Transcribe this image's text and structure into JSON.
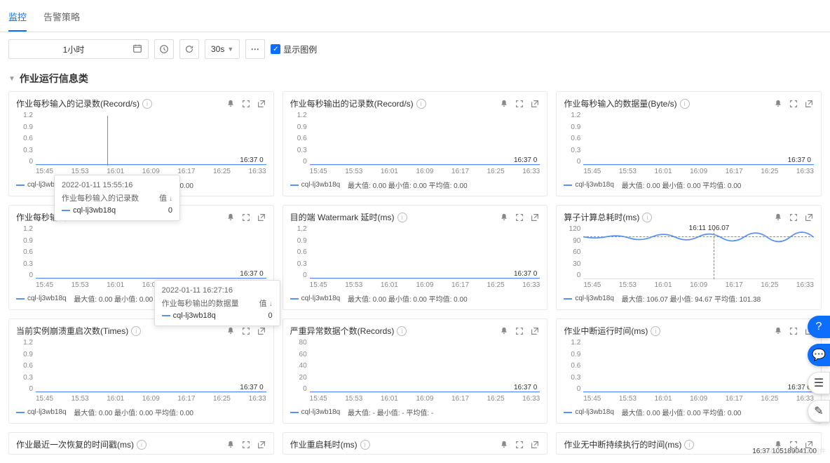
{
  "tabs": {
    "monitor": "监控",
    "alert_policy": "告警策略"
  },
  "toolbar": {
    "time_range": "1小时",
    "refresh_interval": "30s",
    "show_legend_label": "显示图例"
  },
  "section_title": "作业运行信息类",
  "xaxis_ticks": [
    "15:45",
    "15:53",
    "16:01",
    "16:09",
    "16:17",
    "16:25",
    "16:33"
  ],
  "yaxis_small": [
    "1.2",
    "0.9",
    "0.6",
    "0.3",
    "0"
  ],
  "yaxis_records": [
    "80",
    "60",
    "40",
    "20",
    "0"
  ],
  "yaxis_compute": [
    "120",
    "90",
    "60",
    "30",
    "0"
  ],
  "series_name": "cql-lj3wb18q",
  "stats_zero": "最大值: 0.00  最小值: 0.00  平均值: 0.00",
  "stats_dash": "最大值: -  最小值: -  平均值: -",
  "stats_compute": "最大值: 106.07  最小值: 94.67  平均值: 101.38",
  "panels": {
    "p1": {
      "title": "作业每秒输入的记录数(Record/s)",
      "endlabel": "16:37 0"
    },
    "p2": {
      "title": "作业每秒输出的记录数(Record/s)",
      "endlabel": "16:37 0"
    },
    "p3": {
      "title": "作业每秒输入的数据量(Byte/s)",
      "endlabel": "16:37 0"
    },
    "p4": {
      "title": "作业每秒输出的数据量(Byte/s)",
      "endlabel": "16:37 0",
      "truncated_title": "作业每秒输出"
    },
    "p5": {
      "title": "目的端 Watermark 延时(ms)",
      "endlabel": "16:37 0"
    },
    "p6": {
      "title": "算子计算总耗时(ms)",
      "midlabel_time": "16:11",
      "midlabel_value": "106.07"
    },
    "p7": {
      "title": "当前实例崩溃重启次数(Times)",
      "endlabel": "16:37 0"
    },
    "p8": {
      "title": "严重异常数据个数(Records)",
      "endlabel": "16:37 0"
    },
    "p9": {
      "title": "作业中断运行时间(ms)",
      "endlabel": "16:37 0"
    },
    "p10": {
      "title": "作业最近一次恢复的时间戳(ms)"
    },
    "p11": {
      "title": "作业重启耗时(ms)"
    },
    "p12": {
      "title": "作业无中断持续执行的时间(ms)",
      "endlabel": "16:37 105189041.00"
    }
  },
  "tooltip1": {
    "time": "2022-01-11 15:55:16",
    "metric_label": "作业每秒输入的记录数",
    "value_label": "值",
    "series": "cql-lj3wb18q",
    "value": "0"
  },
  "tooltip2": {
    "time": "2022-01-11 16:27:16",
    "metric_label": "作业每秒输出的数据量",
    "value_label": "值",
    "series": "cql-lj3wb18q",
    "value": "0"
  },
  "chart_data": [
    {
      "panel": "p1",
      "type": "line",
      "title": "作业每秒输入的记录数(Record/s)",
      "x_ticks": [
        "15:45",
        "15:53",
        "16:01",
        "16:09",
        "16:17",
        "16:25",
        "16:33",
        "16:37"
      ],
      "ylim": [
        0,
        1.2
      ],
      "series": [
        {
          "name": "cql-lj3wb18q",
          "values_model": "constant",
          "value": 0
        }
      ],
      "stats": {
        "max": 0.0,
        "min": 0.0,
        "avg": 0.0
      }
    },
    {
      "panel": "p2",
      "type": "line",
      "title": "作业每秒输出的记录数(Record/s)",
      "x_ticks": [
        "15:45",
        "15:53",
        "16:01",
        "16:09",
        "16:17",
        "16:25",
        "16:33",
        "16:37"
      ],
      "ylim": [
        0,
        1.2
      ],
      "series": [
        {
          "name": "cql-lj3wb18q",
          "values_model": "constant",
          "value": 0
        }
      ],
      "stats": {
        "max": 0.0,
        "min": 0.0,
        "avg": 0.0
      }
    },
    {
      "panel": "p3",
      "type": "line",
      "title": "作业每秒输入的数据量(Byte/s)",
      "x_ticks": [
        "15:45",
        "15:53",
        "16:01",
        "16:09",
        "16:17",
        "16:25",
        "16:33",
        "16:37"
      ],
      "ylim": [
        0,
        1.2
      ],
      "series": [
        {
          "name": "cql-lj3wb18q",
          "values_model": "constant",
          "value": 0
        }
      ],
      "stats": {
        "max": 0.0,
        "min": 0.0,
        "avg": 0.0
      }
    },
    {
      "panel": "p4",
      "type": "line",
      "title": "作业每秒输出的数据量(Byte/s)",
      "x_ticks": [
        "15:45",
        "15:53",
        "16:01",
        "16:09",
        "16:17",
        "16:25",
        "16:33",
        "16:37"
      ],
      "ylim": [
        0,
        1.2
      ],
      "series": [
        {
          "name": "cql-lj3wb18q",
          "values_model": "constant",
          "value": 0
        }
      ],
      "stats": {
        "max": 0.0,
        "min": 0.0,
        "avg": 0.0
      }
    },
    {
      "panel": "p5",
      "type": "line",
      "title": "目的端 Watermark 延时(ms)",
      "x_ticks": [
        "15:45",
        "15:53",
        "16:01",
        "16:09",
        "16:17",
        "16:25",
        "16:33",
        "16:37"
      ],
      "ylim": [
        0,
        1.2
      ],
      "series": [
        {
          "name": "cql-lj3wb18q",
          "values_model": "constant",
          "value": 0
        }
      ],
      "stats": {
        "max": 0.0,
        "min": 0.0,
        "avg": 0.0
      }
    },
    {
      "panel": "p6",
      "type": "line",
      "title": "算子计算总耗时(ms)",
      "x_ticks": [
        "15:45",
        "15:53",
        "16:01",
        "16:09",
        "16:17",
        "16:25",
        "16:33",
        "16:37"
      ],
      "ylim": [
        0,
        120
      ],
      "series": [
        {
          "name": "cql-lj3wb18q",
          "values_model": "near-constant-wavy",
          "approx_value": 100
        }
      ],
      "highlight": {
        "time": "16:11",
        "value": 106.07
      },
      "stats": {
        "max": 106.07,
        "min": 94.67,
        "avg": 101.38
      }
    },
    {
      "panel": "p7",
      "type": "line",
      "title": "当前实例崩溃重启次数(Times)",
      "x_ticks": [
        "15:45",
        "15:53",
        "16:01",
        "16:09",
        "16:17",
        "16:25",
        "16:33",
        "16:37"
      ],
      "ylim": [
        0,
        1.2
      ],
      "series": [
        {
          "name": "cql-lj3wb18q",
          "values_model": "constant",
          "value": 0
        }
      ],
      "stats": {
        "max": 0.0,
        "min": 0.0,
        "avg": 0.0
      }
    },
    {
      "panel": "p8",
      "type": "line",
      "title": "严重异常数据个数(Records)",
      "x_ticks": [
        "15:45",
        "15:53",
        "16:01",
        "16:09",
        "16:17",
        "16:25",
        "16:33",
        "16:37"
      ],
      "ylim": [
        0,
        80
      ],
      "series": [
        {
          "name": "cql-lj3wb18q",
          "values_model": "constant",
          "value": 0
        }
      ],
      "stats": {
        "max": null,
        "min": null,
        "avg": null
      }
    },
    {
      "panel": "p9",
      "type": "line",
      "title": "作业中断运行时间(ms)",
      "x_ticks": [
        "15:45",
        "15:53",
        "16:01",
        "16:09",
        "16:17",
        "16:25",
        "16:33",
        "16:37"
      ],
      "ylim": [
        0,
        1.2
      ],
      "series": [
        {
          "name": "cql-lj3wb18q",
          "values_model": "constant",
          "value": 0
        }
      ],
      "stats": {
        "max": 0.0,
        "min": 0.0,
        "avg": 0.0
      }
    },
    {
      "panel": "p12",
      "type": "line",
      "title": "作业无中断持续执行的时间(ms)",
      "latest": {
        "time": "16:37",
        "value": 105189041.0
      }
    }
  ],
  "watermark": "CSDN @腾讯云中间件"
}
